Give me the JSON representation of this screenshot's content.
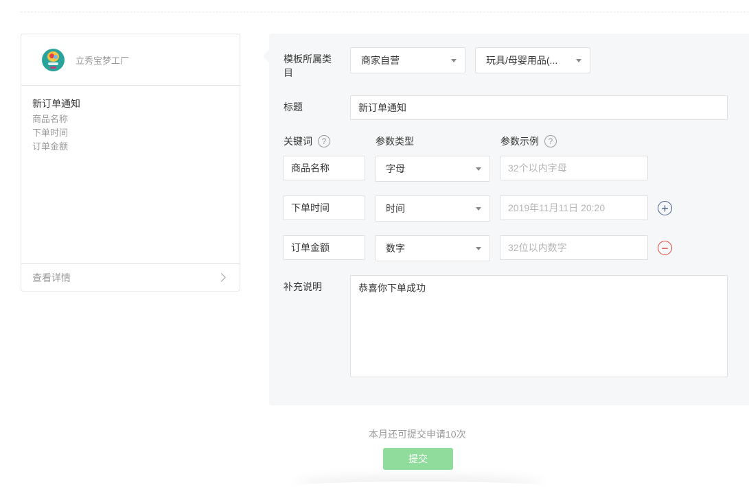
{
  "preview": {
    "merchant_name": "立秀宝梦工厂",
    "title": "新订单通知",
    "fields": [
      "商品名称",
      "下单时间",
      "订单金额"
    ],
    "view_details": "查看详情"
  },
  "form": {
    "category_label": "模板所属类目",
    "category_primary": "商家自营",
    "category_secondary": "玩具/母婴用品(...",
    "title_label": "标题",
    "title_value": "新订单通知",
    "keywords_label": "关键词",
    "param_type_label": "参数类型",
    "param_example_label": "参数示例",
    "help_glyph": "?",
    "rows": [
      {
        "keyword": "商品名称",
        "type": "字母",
        "example_placeholder": "32个以内字母"
      },
      {
        "keyword": "下单时间",
        "type": "时间",
        "example_placeholder": "2019年11月11日 20:20"
      },
      {
        "keyword": "订单金额",
        "type": "数字",
        "example_placeholder": "32位以内数字"
      }
    ],
    "add_glyph": "+",
    "remove_glyph": "−",
    "note_label": "补充说明",
    "note_value": "恭喜你下单成功"
  },
  "footer": {
    "quota_text": "本月还可提交申请10次",
    "submit_label": "提交"
  },
  "colors": {
    "panel_bg": "#f6f7f8",
    "submit_bg": "#8fdc9c",
    "add_icon": "#4a5c8a",
    "remove_icon": "#e2433b"
  }
}
